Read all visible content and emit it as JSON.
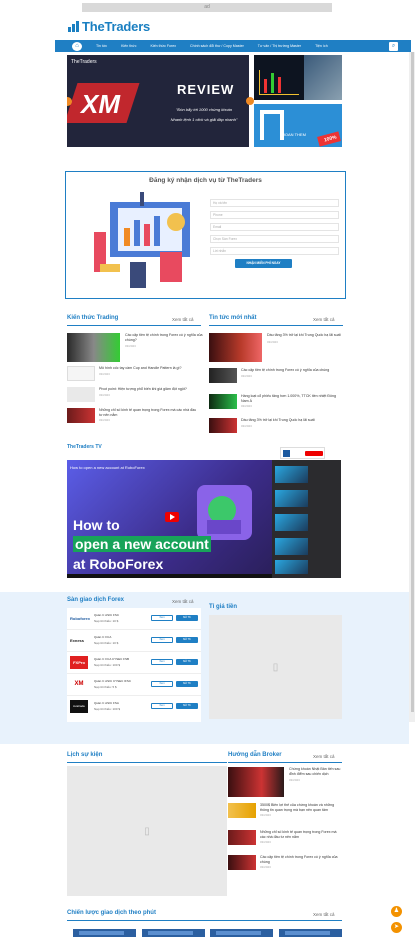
{
  "ad": {
    "label": "ad"
  },
  "logo": {
    "text": "TheTraders"
  },
  "nav": {
    "items": [
      "Tin tức",
      "Kiến thức",
      "Kiến thức Forex",
      "Chính sách đổi thư / Copy Master",
      "Tư vấn / Thị trường Master",
      "Tiện ích"
    ]
  },
  "banner": {
    "brand": "TheTraders",
    "review": "REVIEW",
    "q1": "\"Đòn bẩy tới 1000 chứng khoán",
    "q2": "Nhanh lệnh 1 click và giải đáp nhanh\""
  },
  "side_badge": {
    "text": "HOAN THEM",
    "gift": "100%"
  },
  "register": {
    "title": "Đăng ký nhận dịch vụ từ TheTraders",
    "fields": [
      "Họ và tên",
      "Phone",
      "Email",
      "Chọn Sàn Forex",
      "Lời nhắn"
    ],
    "button": "NHẬN MIỄN PHÍ NGAY"
  },
  "knowledge": {
    "title": "Kiến thức Trading",
    "see_all": "Xem tất cả",
    "items": [
      {
        "title": "Các cặp tiền tệ chính trong Forex có ý nghĩa của chúng?",
        "date": "03/2023"
      },
      {
        "title": "Mô hình cốc tay cầm Cup and Handle Pattern là gì?",
        "date": "03/2023"
      },
      {
        "title": "Pivot point: Hiện tượng phổ biến khi giá giảm đột ngột?",
        "date": "03/2023"
      },
      {
        "title": "Những chỉ số kinh tế quan trọng trong Forex mà các nhà đầu tư nên nắm",
        "date": "03/2023"
      }
    ]
  },
  "news": {
    "title": "Tin tức mới nhất",
    "see_all": "Xem tất cả",
    "items": [
      {
        "title": "Dầu tăng 3% trở lại khi Trung Quốc hạ lãi suất",
        "date": "03/2023"
      },
      {
        "title": "Các cặp tiền tệ chính trong Forex có ý nghĩa của chúng",
        "date": "03/2023"
      },
      {
        "title": "Hàng loạt cổ phiếu tăng hơn 1.000%, TTCK tiền nhiệt Đông Nam Á",
        "date": "03/2023"
      },
      {
        "title": "Dầu tăng 3% trở lại khi Trung Quốc hạ lãi suất",
        "date": "03/2023"
      }
    ]
  },
  "tv": {
    "title": "TheTraders TV",
    "video_title": "How to open a new account at RoboForex",
    "line1": "How to",
    "line2": "open a new account",
    "line3": "at RoboForex"
  },
  "forex": {
    "title": "Sàn giao dịch Forex",
    "see_all": "Xem tất cả",
    "brokers": [
      {
        "logo": "Roboforex",
        "name": "Quản lí: ASIC FSC",
        "min": "Nạp tối thiểu: 10 $",
        "btn1": "Xem",
        "btn2": "Mở TK"
      },
      {
        "logo": "Exness",
        "name": "Quản lí: FCA",
        "min": "Nạp tối thiểu: 10 $",
        "btn1": "Xem",
        "btn2": "Mở TK"
      },
      {
        "logo": "FXPro",
        "name": "Quản lí: FCA CYSEC FSB",
        "min": "Nạp tối thiểu: 100 $",
        "btn1": "Xem",
        "btn2": "Mở TK"
      },
      {
        "logo": "XM",
        "name": "Quản lí: ASIC CYSEC IFSC",
        "min": "Nạp tối thiểu: 5 $",
        "btn1": "Xem",
        "btn2": "Mở TK"
      },
      {
        "logo": "Avatrade",
        "name": "Quản lí: ASIC FSA",
        "min": "Nạp tối thiểu: 100 $",
        "btn1": "Xem",
        "btn2": "Mở TK"
      }
    ]
  },
  "rates": {
    "title": "Tỉ giá tiền"
  },
  "history": {
    "title": "Lịch sự kiện"
  },
  "guide": {
    "title": "Hướng dẫn Broker",
    "see_all": "Xem tất cả",
    "items": [
      {
        "title": "Chứng khoán Nhật Bản tiến sau đỉnh điểm sau chiến dịch",
        "date": "03/2023"
      },
      {
        "title": "3500$ Biên lợi thế của chứng khoán và những thông tin quan trọng mà bạn nên quan tâm",
        "date": "03/2023"
      },
      {
        "title": "Những chỉ số kinh tế quan trọng trong Forex mà các nhà đầu tư nên nắm",
        "date": "03/2023"
      },
      {
        "title": "Các cặp tiền tệ chính trong Forex có ý nghĩa của chúng",
        "date": "03/2023"
      }
    ]
  },
  "strategy": {
    "title": "Chiến lược giao dịch theo phút",
    "see_all": "Xem tất cả"
  },
  "colors": {
    "accent": "#1f7fc4",
    "orange": "#f08a24"
  }
}
